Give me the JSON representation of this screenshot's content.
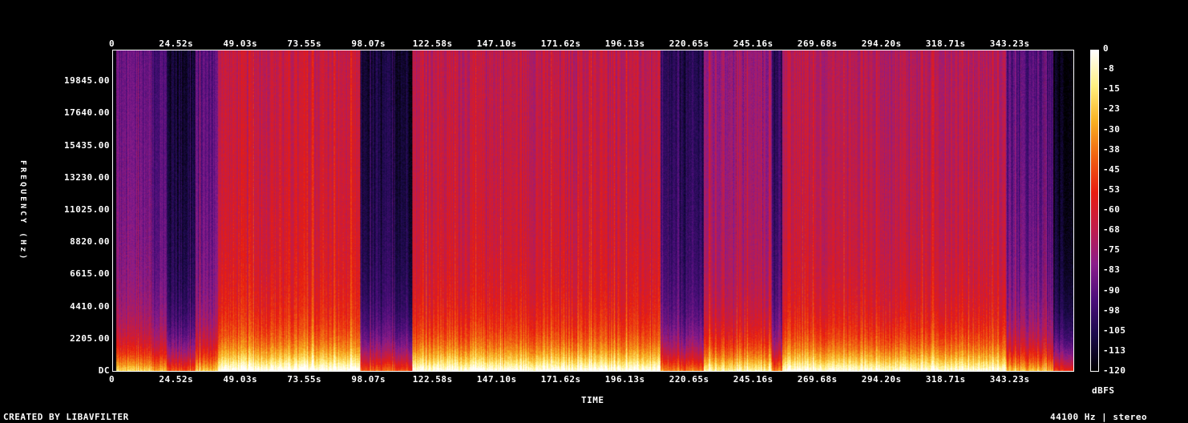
{
  "chart_data": {
    "type": "heatmap",
    "title": "",
    "xlabel": "TIME",
    "ylabel": "FREQUENCY (Hz)",
    "colorbar_label": "dBFS",
    "x_ticks": [
      "0",
      "24.52s",
      "49.03s",
      "73.55s",
      "98.07s",
      "122.58s",
      "147.10s",
      "171.62s",
      "196.13s",
      "220.65s",
      "245.16s",
      "269.68s",
      "294.20s",
      "318.71s",
      "343.23s"
    ],
    "y_ticks": [
      "DC",
      "2205.00",
      "4410.00",
      "6615.00",
      "8820.00",
      "11025.00",
      "13230.00",
      "15435.00",
      "17640.00",
      "19845.00"
    ],
    "colorbar_ticks": [
      "0",
      "-8",
      "-15",
      "-23",
      "-30",
      "-38",
      "-45",
      "-53",
      "-60",
      "-68",
      "-75",
      "-83",
      "-90",
      "-98",
      "-105",
      "-113",
      "-120"
    ],
    "xlim": [
      0,
      367.8
    ],
    "ylim": [
      0,
      22050
    ],
    "clim": [
      -120,
      0
    ],
    "colormap": [
      "#000000",
      "#1a0a4a",
      "#4b0e7a",
      "#8a1c8a",
      "#c01c4a",
      "#e81c10",
      "#f06010",
      "#f8b020",
      "#fff080",
      "#ffffff"
    ],
    "segments": [
      {
        "start": 0,
        "end": 1.2,
        "level": -120
      },
      {
        "start": 1.2,
        "end": 14.5,
        "level": -82
      },
      {
        "start": 14.5,
        "end": 20.5,
        "level": -88
      },
      {
        "start": 20.5,
        "end": 31.5,
        "level": -105
      },
      {
        "start": 31.5,
        "end": 40,
        "level": -85
      },
      {
        "start": 40,
        "end": 94.5,
        "level": -60
      },
      {
        "start": 94.5,
        "end": 114.5,
        "level": -105
      },
      {
        "start": 114.5,
        "end": 209.5,
        "level": -62
      },
      {
        "start": 209.5,
        "end": 226,
        "level": -100
      },
      {
        "start": 226,
        "end": 252,
        "level": -72
      },
      {
        "start": 252,
        "end": 256,
        "level": -98
      },
      {
        "start": 256,
        "end": 342,
        "level": -64
      },
      {
        "start": 342,
        "end": 360,
        "level": -88
      },
      {
        "start": 360,
        "end": 367.8,
        "level": -112
      }
    ]
  },
  "footer": {
    "left": "CREATED BY LIBAVFILTER",
    "right": "44100 Hz | stereo"
  }
}
